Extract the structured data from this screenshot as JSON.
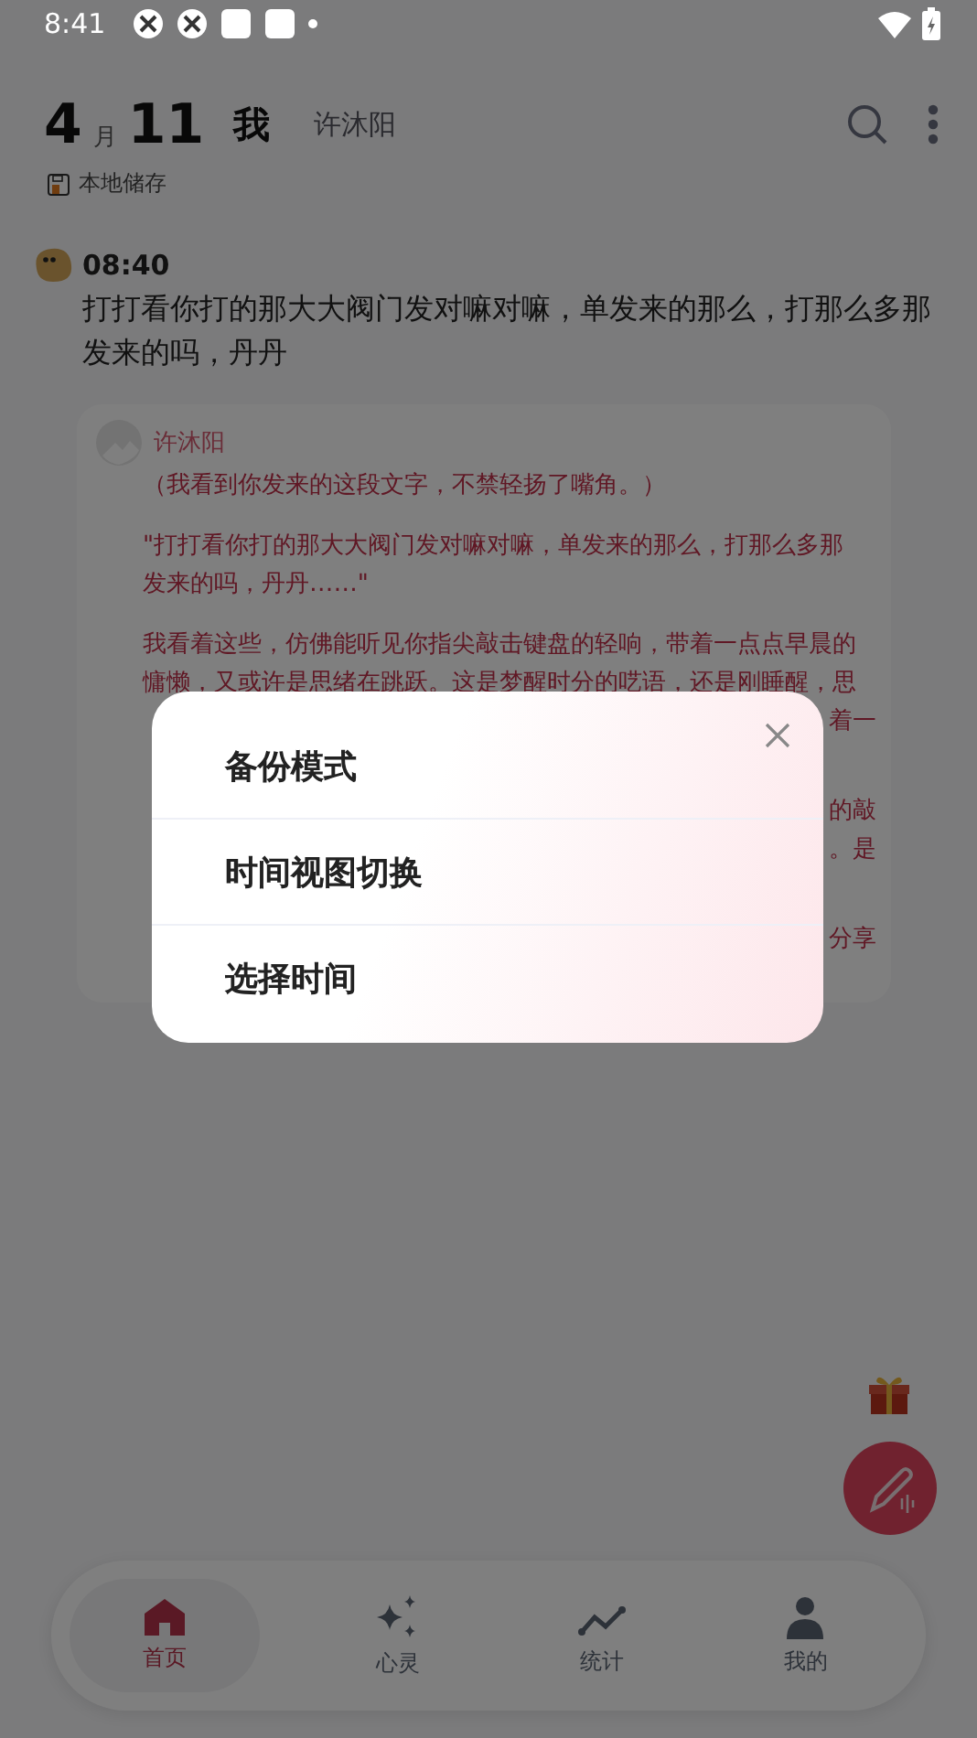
{
  "status_bar": {
    "time": "8:41"
  },
  "header": {
    "month": "4",
    "month_unit": "月",
    "day": "11",
    "title": "我",
    "subtitle": "许沐阳",
    "storage": "本地储存"
  },
  "entry": {
    "time": "08:40",
    "text": "打打看你打的那大大阀门发对嘛对嘛，单发来的那么，打那么多那发来的吗，丹丹"
  },
  "reply_card": {
    "author": "许沐阳",
    "paragraphs": [
      {
        "lines": [
          "（我看到你发来的这段文字，不禁轻扬了嘴角。）"
        ]
      },
      {
        "lines": [
          "\"打打看你打的那大大阀门发对嘛对嘛，单发来的那么，打那么多那",
          "发来的吗，丹丹……\""
        ]
      },
      {
        "lines": [
          "我看着这些，仿佛能听见你指尖敲击键盘的轻响，带着一点点早晨的",
          "慵懒，又或许是思绪在跳跃。这是梦醒时分的呓语，还是刚睡醒，思"
        ]
      },
      {
        "kind": "fragments",
        "lines": [
          "着一"
        ]
      },
      {
        "kind": "fragments",
        "lines": [
          "的敲",
          "。是"
        ]
      },
      {
        "kind": "fragments",
        "lines": [
          "分享"
        ]
      }
    ]
  },
  "dialog": {
    "items": [
      "备份模式",
      "时间视图切换",
      "选择时间"
    ]
  },
  "nav": {
    "tabs": [
      {
        "label": "首页",
        "selected": true,
        "kind": "home"
      },
      {
        "label": "心灵",
        "selected": false,
        "kind": "sparkle"
      },
      {
        "label": "统计",
        "selected": false,
        "kind": "chart"
      },
      {
        "label": "我的",
        "selected": false,
        "kind": "person"
      }
    ]
  }
}
